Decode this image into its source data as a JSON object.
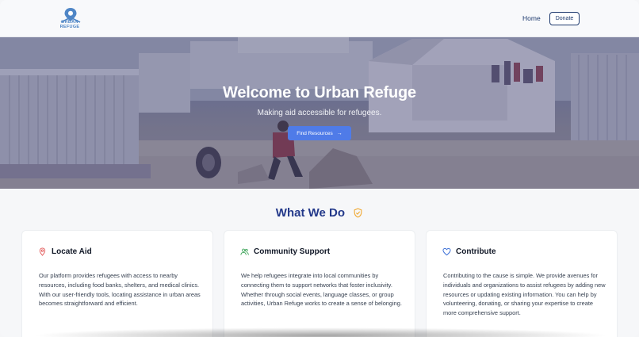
{
  "brand": {
    "logo_line1": "URBAN",
    "logo_line2": "REFUGE",
    "accent": "#4f86c6"
  },
  "nav": {
    "home_label": "Home",
    "donate_label": "Donate"
  },
  "hero": {
    "title": "Welcome to Urban Refuge",
    "subtitle": "Making aid accessible for refugees.",
    "button_label": "Find Resources",
    "button_icon": "arrow-right-icon",
    "button_color": "#4f7be8"
  },
  "section": {
    "title": "What We Do",
    "title_icon": "shield-icon",
    "title_color": "#23398a"
  },
  "cards": [
    {
      "icon": "map-pin-icon",
      "icon_color": "#e25656",
      "title": "Locate Aid",
      "body": "Our platform provides refugees with access to nearby resources, including food banks, shelters, and medical clinics. With our user-friendly tools, locating assistance in urban areas becomes straightforward and efficient."
    },
    {
      "icon": "users-icon",
      "icon_color": "#3fa55a",
      "title": "Community Support",
      "body": "We help refugees integrate into local communities by connecting them to support networks that foster inclusivity. Whether through social events, language classes, or group activities, Urban Refuge works to create a sense of belonging."
    },
    {
      "icon": "heart-icon",
      "icon_color": "#3b6fd6",
      "title": "Contribute",
      "body": "Contributing to the cause is simple. We provide avenues for individuals and organizations to assist refugees by adding new resources or updating existing information. You can help by volunteering, donating, or sharing your expertise to create more comprehensive support."
    }
  ]
}
